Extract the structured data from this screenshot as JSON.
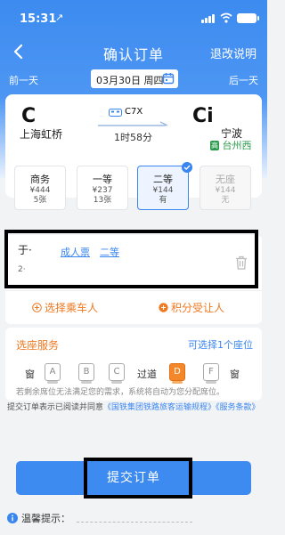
{
  "status": {
    "time": "15:31",
    "location_symbol": "↗"
  },
  "nav": {
    "title": "确认订单",
    "right_link": "退改说明",
    "back_icon": "chevron-left-icon"
  },
  "date_bar": {
    "prev_label": "前一天",
    "next_label": "后一天",
    "date": "03月30日",
    "weekday": "周四",
    "calendar_icon": "calendar-icon"
  },
  "train": {
    "dep_time": "C",
    "dep_station": "上海虹桥",
    "arr_time": "Ci",
    "arr_station": "宁波",
    "arr_alt_station": "台州西",
    "arr_alt_badge": "高",
    "train_no": "C7X",
    "duration": "1时58分"
  },
  "seats": [
    {
      "name": "商务",
      "price": "¥444",
      "count": "5张",
      "state": "normal"
    },
    {
      "name": "一等",
      "price": "¥237",
      "count": "13张",
      "state": "normal"
    },
    {
      "name": "二等",
      "price": "¥144",
      "count": "有",
      "state": "selected"
    },
    {
      "name": "无座",
      "price": "¥144",
      "count": "无",
      "state": "disabled"
    }
  ],
  "passenger": {
    "name": "于·",
    "ticket_type": "成人票",
    "seat_class": "二等",
    "id_masked": "2·"
  },
  "passenger_actions": {
    "add_passenger": "选择乘车人",
    "transfer_points": "积分受让人"
  },
  "seat_service": {
    "title": "选座服务",
    "hint": "可选择1个座位",
    "window_label": "窗",
    "aisle_label": "过道",
    "letters": [
      "A",
      "B",
      "C",
      "D",
      "F"
    ],
    "selected": "D",
    "note": "若剩余席位无法满足您的需求，系统将自动为您分配席位。"
  },
  "agreement": {
    "prefix": "提交订单表示已阅读并同意",
    "link": "《国铁集团铁路旅客运输规程》《服务条款》"
  },
  "submit": {
    "label": "提交订单"
  },
  "tips": {
    "label": "温馨提示："
  },
  "colors": {
    "brand_blue": "#3d8bf0",
    "accent_orange": "#f07820",
    "seat_selected": "#f4872a",
    "highlight_border": "#000000"
  }
}
